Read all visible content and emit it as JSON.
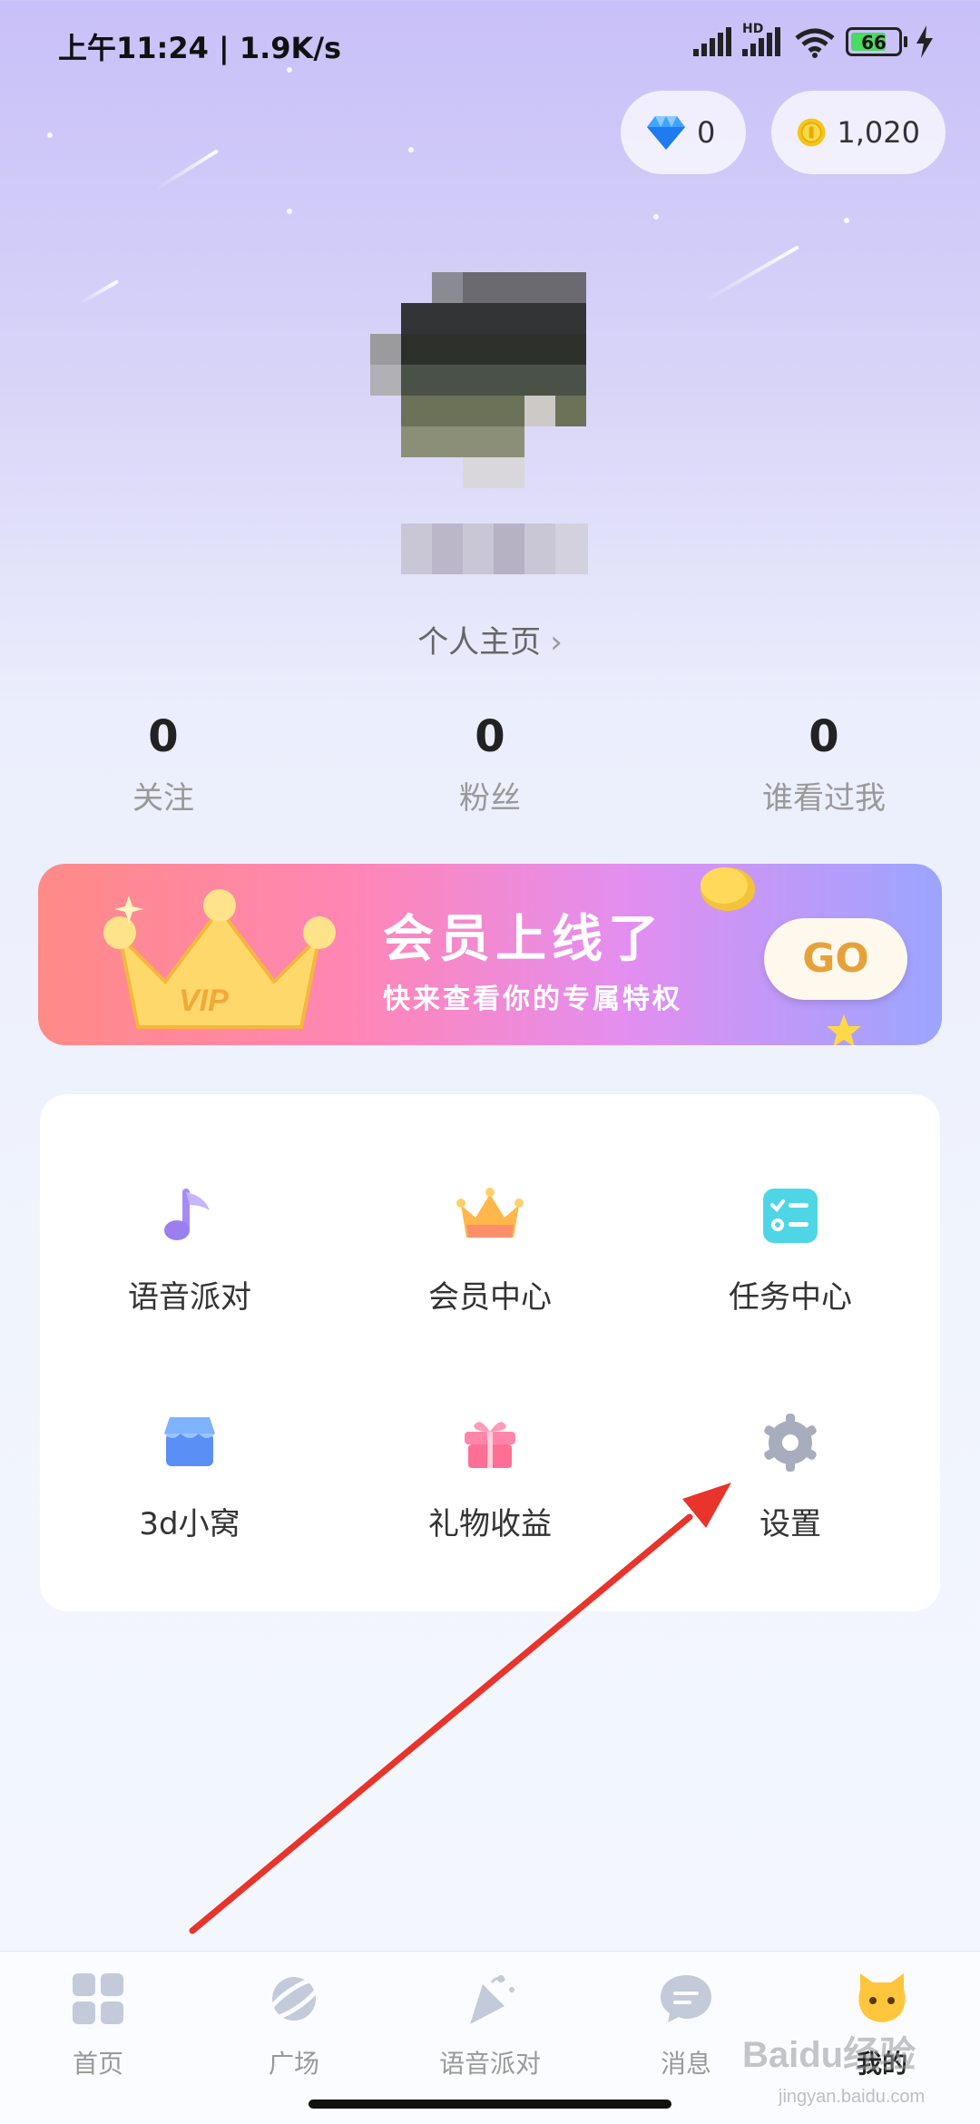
{
  "status_bar": {
    "time": "上午11:24",
    "net_speed": "1.9K/s",
    "hd_label": "HD",
    "battery": "66"
  },
  "currency": {
    "diamond_value": "0",
    "coin_value": "1,020"
  },
  "profile": {
    "home_link": "个人主页",
    "home_chevron": "›"
  },
  "stats": [
    {
      "value": "0",
      "label": "关注"
    },
    {
      "value": "0",
      "label": "粉丝"
    },
    {
      "value": "0",
      "label": "谁看过我"
    }
  ],
  "vip_banner": {
    "badge": "VIP",
    "title": "会员上线了",
    "subtitle": "快来查看你的专属特权",
    "button": "GO"
  },
  "menu": [
    {
      "label": "语音派对",
      "icon": "music-note-icon"
    },
    {
      "label": "会员中心",
      "icon": "crown-icon"
    },
    {
      "label": "任务中心",
      "icon": "task-list-icon"
    },
    {
      "label": "3d小窝",
      "icon": "shop-icon"
    },
    {
      "label": "礼物收益",
      "icon": "gift-icon"
    },
    {
      "label": "设置",
      "icon": "gear-icon"
    }
  ],
  "nav": [
    {
      "label": "首页",
      "icon": "grid-icon"
    },
    {
      "label": "广场",
      "icon": "planet-icon"
    },
    {
      "label": "语音派对",
      "icon": "party-popper-icon"
    },
    {
      "label": "消息",
      "icon": "chat-bubble-icon"
    },
    {
      "label": "我的",
      "icon": "cat-face-icon"
    }
  ],
  "watermark": {
    "text": "Baidu经验",
    "url": "jingyan.baidu.com"
  },
  "colors": {
    "accent_purple": "#9b7ff0",
    "coin_gold": "#f5c518",
    "arrow_red": "#e8342a",
    "go_text": "#e6a23a"
  }
}
